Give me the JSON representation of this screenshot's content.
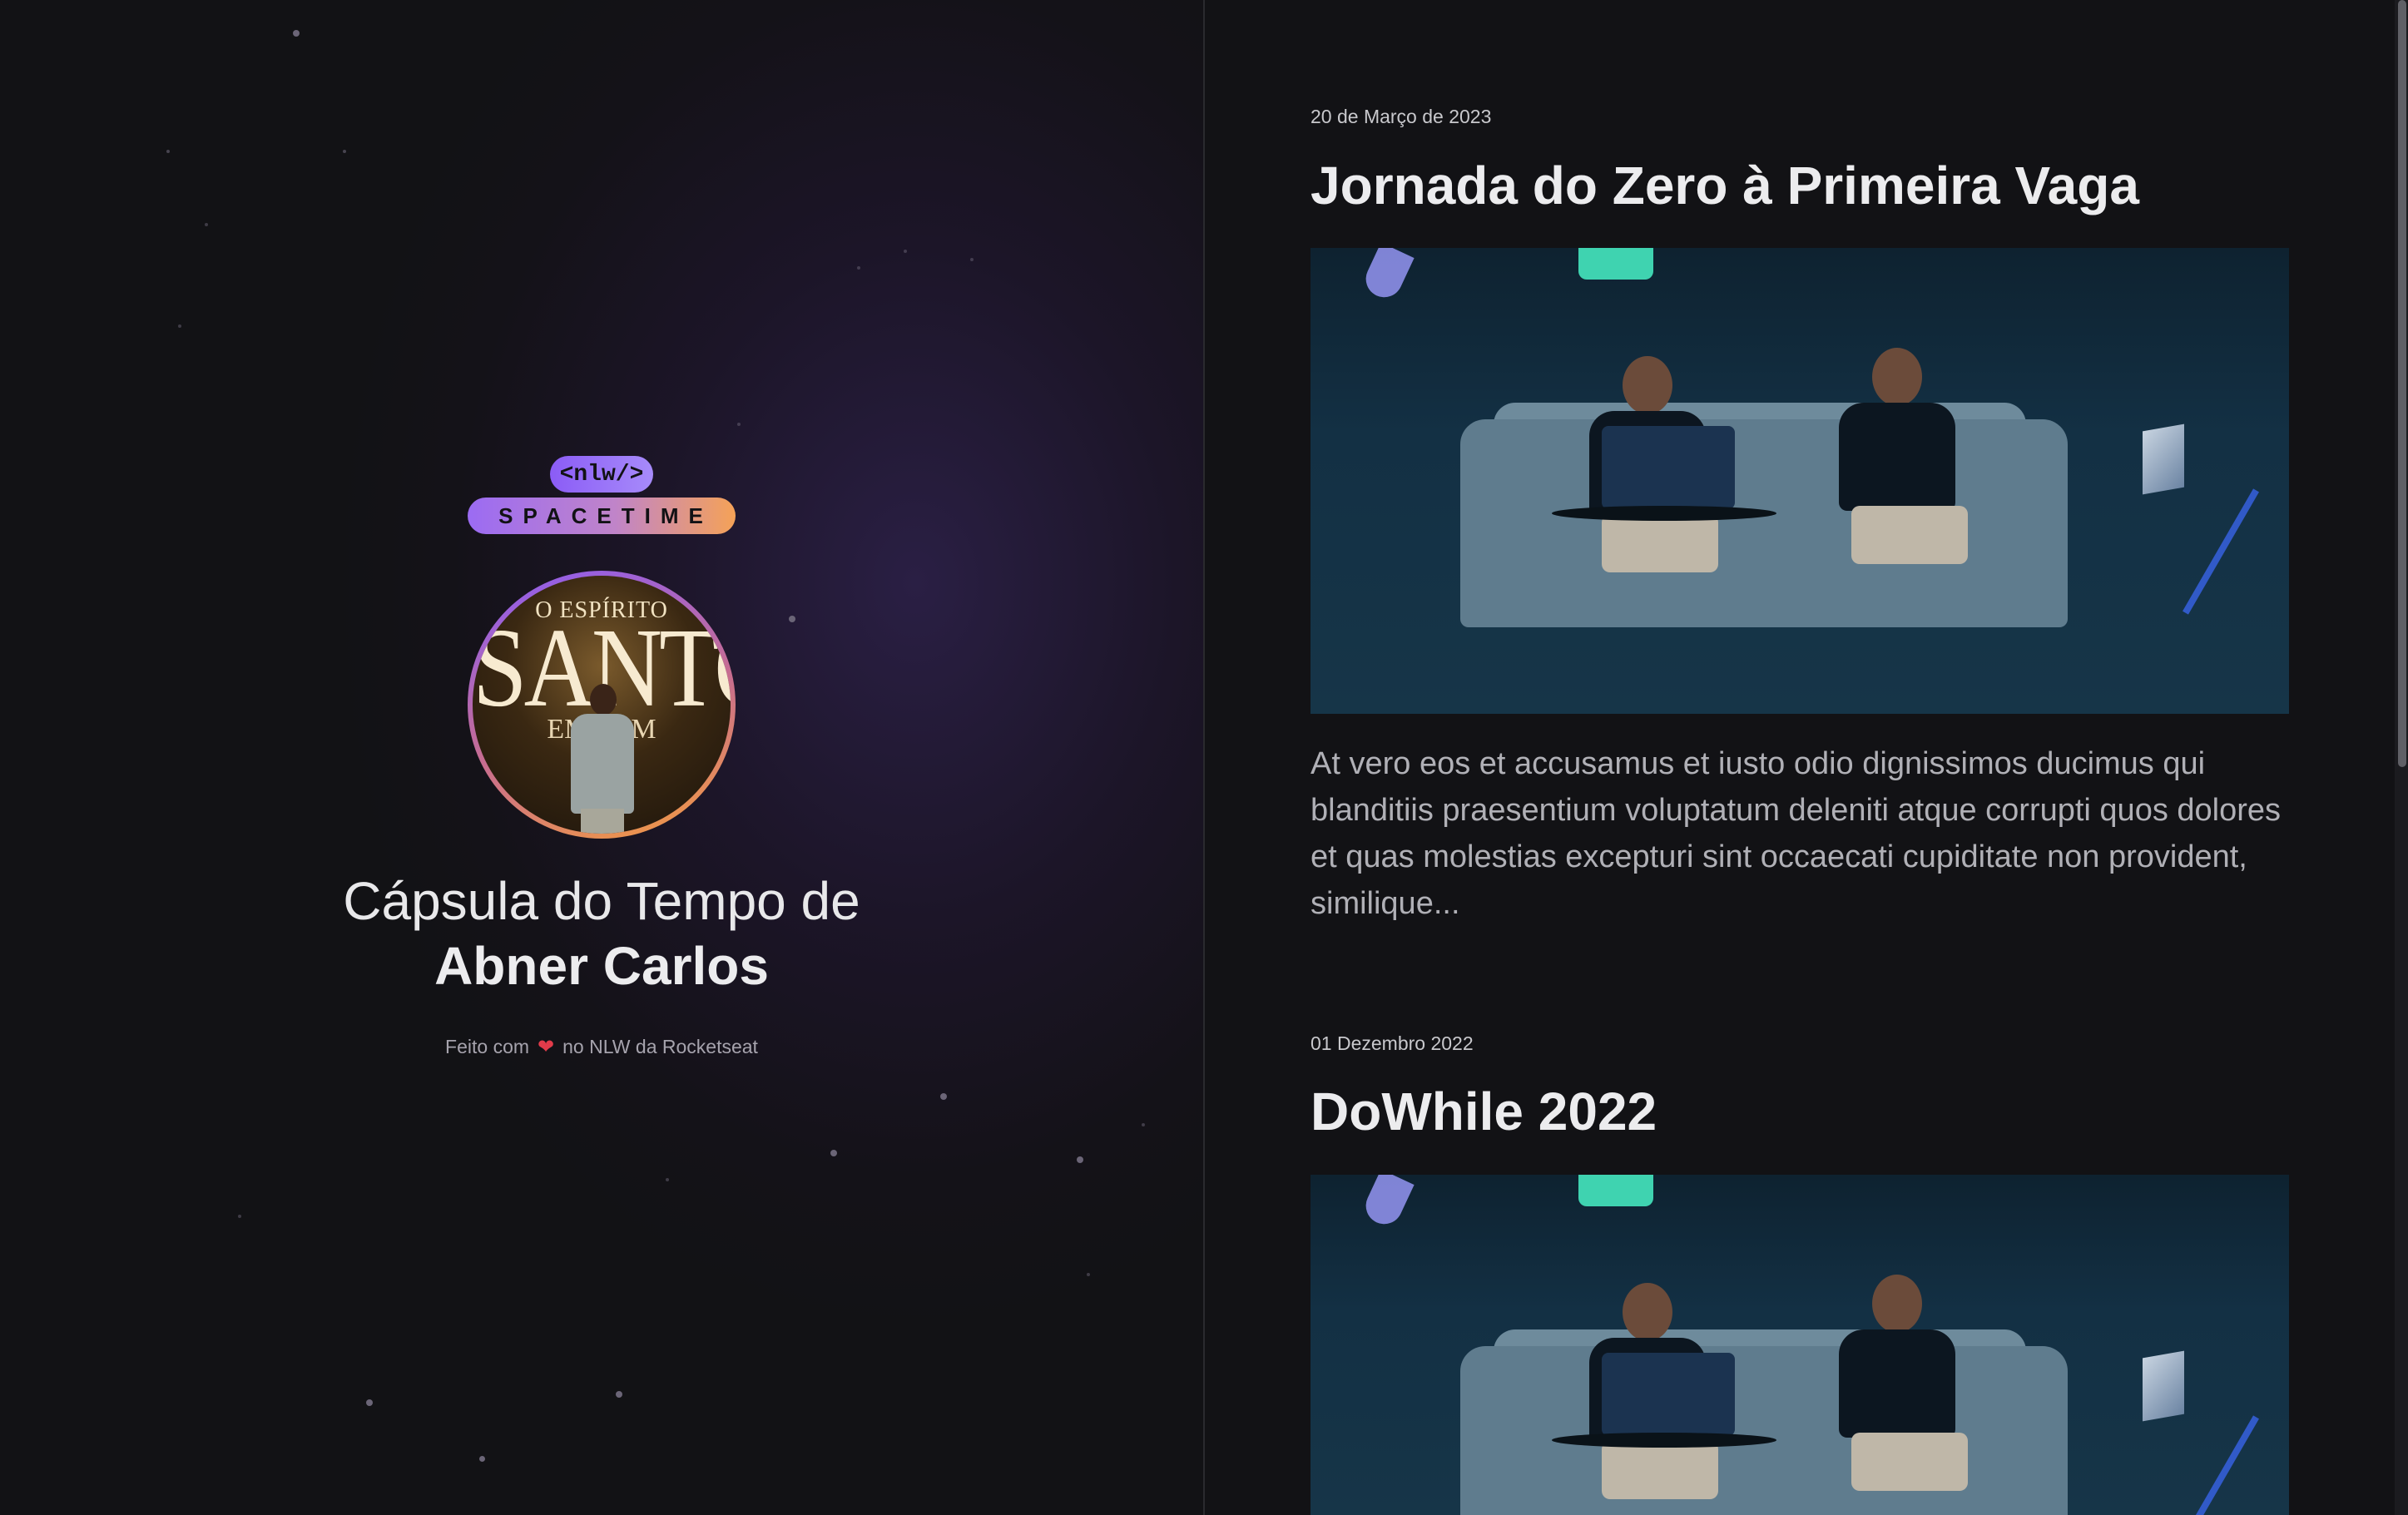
{
  "hero": {
    "logo_top": "<nlw/>",
    "logo_bottom": "SPACETIME",
    "avatar_text_top": "O ESPÍRITO",
    "avatar_text_main": "SANTO",
    "avatar_text_bottom": "EM MIM",
    "title_prefix": "Cápsula do Tempo de",
    "title_name": "Abner Carlos",
    "credit_before": "Feito com",
    "credit_heart": "❤",
    "credit_after": "no NLW da Rocketseat"
  },
  "memories": [
    {
      "date": "20 de Março de 2023",
      "title": "Jornada do Zero à Primeira Vaga",
      "excerpt": "At vero eos et accusamus et iusto odio dignissimos ducimus qui blanditiis praesentium voluptatum deleniti atque corrupti quos dolores et quas molestias excepturi sint occaecati cupiditate non provident, similique..."
    },
    {
      "date": "01 Dezembro 2022",
      "title": "DoWhile 2022"
    }
  ],
  "colors": {
    "background": "#121215",
    "accent_purple": "#8b5cf6",
    "accent_orange": "#f59e3b",
    "heart": "#e23b4a"
  }
}
